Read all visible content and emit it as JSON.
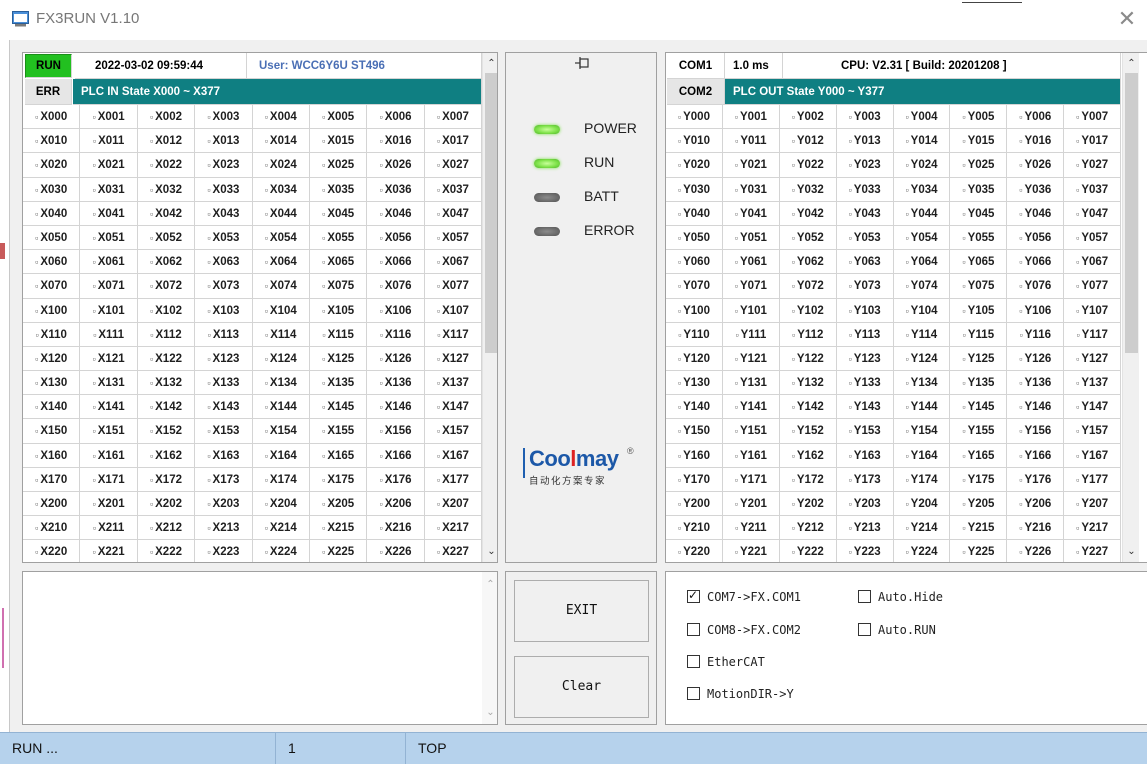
{
  "window": {
    "title": "FX3RUN V1.10",
    "close_glyph": "✕"
  },
  "left_panel": {
    "run_badge": "RUN",
    "err_badge": "ERR",
    "datetime": "2022-03-02 09:59:44",
    "user": "User: WCC6Y6U ST496",
    "header_bar": "PLC IN State X000 ~ X377",
    "prefix": "X"
  },
  "right_panel": {
    "com1": "COM1",
    "com2": "COM2",
    "scan_time": "1.0 ms",
    "cpu": "CPU: V2.31 [ Build: 20201208 ]",
    "header_bar": "PLC OUT State Y000 ~ Y377",
    "prefix": "Y"
  },
  "io_rows": [
    "00",
    "01",
    "02",
    "03",
    "04",
    "05",
    "06",
    "07",
    "10",
    "11",
    "12",
    "13",
    "14",
    "15",
    "16",
    "17",
    "20",
    "21",
    "22"
  ],
  "io_cols": [
    "0",
    "1",
    "2",
    "3",
    "4",
    "5",
    "6",
    "7"
  ],
  "indicators": [
    {
      "label": "POWER",
      "state": "on"
    },
    {
      "label": "RUN",
      "state": "on"
    },
    {
      "label": "BATT",
      "state": "off"
    },
    {
      "label": "ERROR",
      "state": "off"
    }
  ],
  "logo": {
    "main_a": "Coo",
    "main_b": "l",
    "main_c": "may",
    "reg": "®",
    "sub": "自动化方案专家"
  },
  "buttons": {
    "exit": "EXIT",
    "clear": "Clear"
  },
  "options": {
    "com7": {
      "label": "COM7->FX.COM1",
      "checked": true
    },
    "com8": {
      "label": "COM8->FX.COM2",
      "checked": false
    },
    "ethercat": {
      "label": "EtherCAT",
      "checked": false
    },
    "motiondir": {
      "label": "MotionDIR->Y",
      "checked": false
    },
    "autohide": {
      "label": "Auto.Hide",
      "checked": false
    },
    "autorun": {
      "label": "Auto.RUN",
      "checked": false
    }
  },
  "statusbar": {
    "state": "RUN ...",
    "number": "1",
    "position": "TOP"
  },
  "colors": {
    "run_green": "#22c020",
    "teal": "#0f7f82",
    "status_blue": "#b6d2ec",
    "led_green": "#7fe24a"
  }
}
